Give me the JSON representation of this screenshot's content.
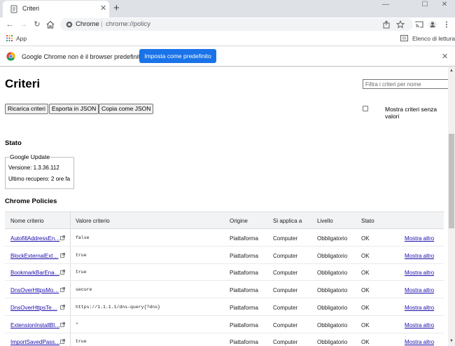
{
  "window": {
    "tab_title": "Criteri",
    "tab_close": "✕",
    "new_tab": "+",
    "minimize": "—",
    "maximize": "☐",
    "close": "✕"
  },
  "toolbar": {
    "omnibox_label": "Chrome",
    "omnibox_separator": "|",
    "url": "chrome://policy"
  },
  "bookmarks": {
    "apps_label": "App",
    "reading_list_label": "Elenco di lettura"
  },
  "infobar": {
    "message": "Google Chrome non è il browser predefinito",
    "button_label": "Imposta come predefinito",
    "close": "✕"
  },
  "page": {
    "title": "Criteri",
    "filter_placeholder": "Filtra i criteri per nome",
    "buttons": {
      "reload": "Ricarica criteri",
      "export": "Esporta in JSON",
      "copy": "Copia come JSON"
    },
    "show_empty_label": "Mostra criteri senza valori",
    "status_heading": "Stato",
    "status_box": {
      "legend": "Google Update",
      "version": "Versione: 1.3.36.112",
      "last_fetch": "Ultimo recupero: 2 ore fa"
    },
    "policies_heading": "Chrome Policies",
    "table": {
      "headers": {
        "name": "Nome criterio",
        "value": "Valore criterio",
        "origin": "Origine",
        "scope": "Si applica a",
        "level": "Livello",
        "status": "Stato"
      },
      "rows": [
        {
          "name": "AutofillAddressEn…",
          "value": "false",
          "origin": "Piattaforma",
          "scope": "Computer",
          "level": "Obbligatorio",
          "status": "OK",
          "more": "Mostra altro"
        },
        {
          "name": "BlockExternalExt…",
          "value": "true",
          "origin": "Piattaforma",
          "scope": "Computer",
          "level": "Obbligatorio",
          "status": "OK",
          "more": "Mostra altro"
        },
        {
          "name": "BookmarkBarEna…",
          "value": "true",
          "origin": "Piattaforma",
          "scope": "Computer",
          "level": "Obbligatorio",
          "status": "OK",
          "more": "Mostra altro"
        },
        {
          "name": "DnsOverHttpsMo…",
          "value": "secure",
          "origin": "Piattaforma",
          "scope": "Computer",
          "level": "Obbligatorio",
          "status": "OK",
          "more": "Mostra altro"
        },
        {
          "name": "DnsOverHttpsTe…",
          "value": "https://1.1.1.1/dns-query{?dns}",
          "origin": "Piattaforma",
          "scope": "Computer",
          "level": "Obbligatorio",
          "status": "OK",
          "more": "Mostra altro"
        },
        {
          "name": "ExtensionInstallBl…",
          "value": "*",
          "origin": "Piattaforma",
          "scope": "Computer",
          "level": "Obbligatorio",
          "status": "OK",
          "more": "Mostra altro"
        },
        {
          "name": "ImportSavedPass…",
          "value": "true",
          "origin": "Piattaforma",
          "scope": "Computer",
          "level": "Obbligatorio",
          "status": "OK",
          "more": "Mostra altro"
        }
      ]
    }
  },
  "colors": {
    "accent": "#1a73e8",
    "link": "#1a0dab",
    "tabstrip": "#dee1e6"
  }
}
